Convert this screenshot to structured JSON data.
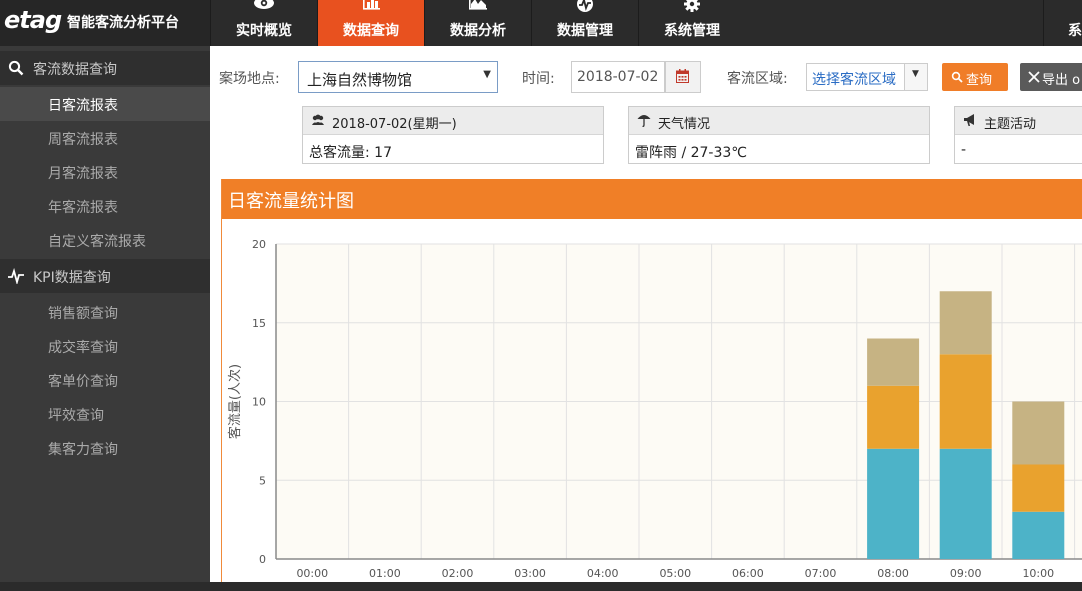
{
  "app": {
    "logo_text": "etag",
    "title": "智能客流分析平台"
  },
  "nav": [
    {
      "label": "实时概览",
      "icon": "eye-icon",
      "active": false
    },
    {
      "label": "数据查询",
      "icon": "bar-chart-icon",
      "active": true
    },
    {
      "label": "数据分析",
      "icon": "area-chart-icon",
      "active": false
    },
    {
      "label": "数据管理",
      "icon": "pulse-icon",
      "active": false
    },
    {
      "label": "系统管理",
      "icon": "gear-icon",
      "active": false
    },
    {
      "label": "系",
      "icon": "",
      "active": false
    }
  ],
  "sidebar": {
    "sections": [
      {
        "label": "客流数据查询",
        "icon": "search-icon",
        "items": [
          "日客流报表",
          "周客流报表",
          "月客流报表",
          "年客流报表",
          "自定义客流报表"
        ]
      },
      {
        "label": "KPI数据查询",
        "icon": "pulse-icon",
        "items": [
          "销售额查询",
          "成交率查询",
          "客单价查询",
          "坪效查询",
          "集客力查询"
        ]
      }
    ],
    "active_item": "日客流报表"
  },
  "filters": {
    "site_label": "案场地点:",
    "site_value": "上海自然博物馆",
    "time_label": "时间:",
    "date_value": "2018-07-02",
    "area_label": "客流区域:",
    "area_placeholder": "选择客流区域",
    "query_button": "查询",
    "export_button": "导出 o"
  },
  "info": {
    "date": {
      "header": "2018-07-02(星期一)",
      "body": "总客流量: 17",
      "icon": "users-icon"
    },
    "weather": {
      "header": "天气情况",
      "body": "雷阵雨 / 27-33℃",
      "icon": "umbrella-icon"
    },
    "activity": {
      "header": "主题活动",
      "body": "-",
      "icon": "bullhorn-icon"
    }
  },
  "chart_title": "日客流量统计图",
  "chart_data": {
    "type": "bar",
    "stacked": true,
    "categories": [
      "00:00",
      "01:00",
      "02:00",
      "03:00",
      "04:00",
      "05:00",
      "06:00",
      "07:00",
      "08:00",
      "09:00",
      "10:00"
    ],
    "series": [
      {
        "values": [
          0,
          0,
          0,
          0,
          0,
          0,
          0,
          0,
          7,
          7,
          3
        ],
        "color": "#4db3c8"
      },
      {
        "values": [
          0,
          0,
          0,
          0,
          0,
          0,
          0,
          0,
          4,
          6,
          3
        ],
        "color": "#e9a22e"
      },
      {
        "values": [
          0,
          0,
          0,
          0,
          0,
          0,
          0,
          0,
          3,
          4,
          4
        ],
        "color": "#c6b383"
      }
    ],
    "ylabel": "客流量(人次)",
    "ylim": [
      0,
      20
    ],
    "yticks": [
      0,
      5,
      10,
      15,
      20
    ],
    "grid": true,
    "background": "#fdfbf5"
  }
}
